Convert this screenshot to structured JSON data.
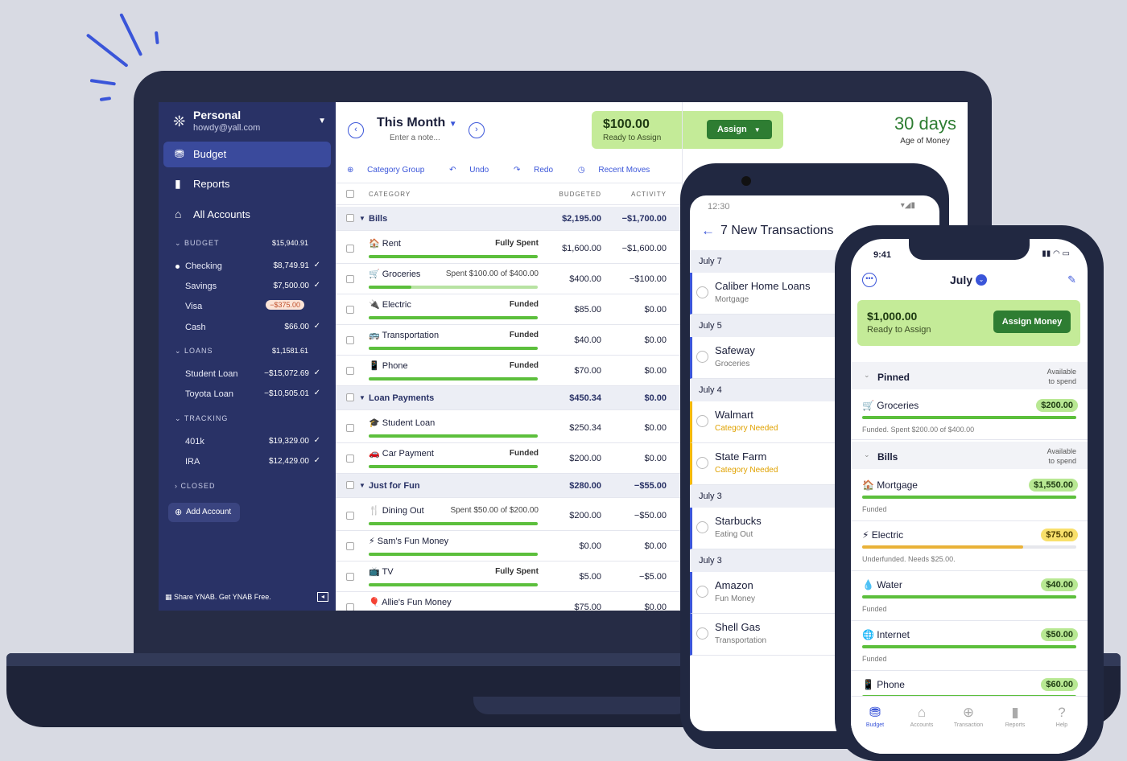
{
  "sidebar": {
    "budget_name": "Personal",
    "email": "howdy@yall.com",
    "nav": [
      {
        "label": "Budget",
        "icon": "budget-icon"
      },
      {
        "label": "Reports",
        "icon": "reports-icon"
      },
      {
        "label": "All Accounts",
        "icon": "bank-icon"
      }
    ],
    "groups": {
      "budget": {
        "label": "BUDGET",
        "amount": "$15,940.91"
      },
      "loans": {
        "label": "LOANS",
        "amount": "$1,1581.61"
      },
      "tracking": {
        "label": "TRACKING",
        "amount": ""
      },
      "closed": {
        "label": "CLOSED",
        "amount": ""
      }
    },
    "accounts": [
      {
        "name": "Checking",
        "amount": "$8,749.91"
      },
      {
        "name": "Savings",
        "amount": "$7,500.00"
      },
      {
        "name": "Visa",
        "amount": "−$375.00"
      },
      {
        "name": "Cash",
        "amount": "$66.00"
      },
      {
        "name": "Student Loan",
        "amount": "−$15,072.69"
      },
      {
        "name": "Toyota Loan",
        "amount": "−$10,505.01"
      },
      {
        "name": "401k",
        "amount": "$19,329.00"
      },
      {
        "name": "IRA",
        "amount": "$12,429.00"
      }
    ],
    "add_account": "Add Account",
    "share_text": "Share YNAB. Get YNAB Free."
  },
  "header": {
    "month": "This Month",
    "note_placeholder": "Enter a note...",
    "ready_amount": "$100.00",
    "ready_label": "Ready to Assign",
    "assign_label": "Assign",
    "age_value": "30 days",
    "age_label": "Age of Money"
  },
  "toolbar": {
    "category_group": "Category Group",
    "undo": "Undo",
    "redo": "Redo",
    "recent_moves": "Recent Moves"
  },
  "table": {
    "col_category": "CATEGORY",
    "col_budgeted": "BUDGETED",
    "col_activity": "ACTIVITY",
    "rows": [
      {
        "type": "group",
        "name": "Bills",
        "budgeted": "$2,195.00",
        "activity": "−$1,700.00"
      },
      {
        "type": "cat",
        "name": "🏠 Rent",
        "status": "Fully Spent",
        "budgeted": "$1,600.00",
        "activity": "−$1,600.00",
        "fill": 1.0
      },
      {
        "type": "cat",
        "name": "🛒 Groceries",
        "status": "Spent $100.00 of $400.00",
        "budgeted": "$400.00",
        "activity": "−$100.00",
        "fill": 0.25
      },
      {
        "type": "cat",
        "name": "🔌 Electric",
        "status": "Funded",
        "budgeted": "$85.00",
        "activity": "$0.00",
        "fill": 1.0
      },
      {
        "type": "cat",
        "name": "🚌 Transportation",
        "status": "Funded",
        "budgeted": "$40.00",
        "activity": "$0.00",
        "fill": 1.0
      },
      {
        "type": "cat",
        "name": "📱 Phone",
        "status": "Funded",
        "budgeted": "$70.00",
        "activity": "$0.00",
        "fill": 1.0
      },
      {
        "type": "group",
        "name": "Loan Payments",
        "budgeted": "$450.34",
        "activity": "$0.00"
      },
      {
        "type": "cat",
        "name": "🎓 Student Loan",
        "status": "",
        "budgeted": "$250.34",
        "activity": "$0.00",
        "fill": 1.0
      },
      {
        "type": "cat",
        "name": "🚗 Car Payment",
        "status": "Funded",
        "budgeted": "$200.00",
        "activity": "$0.00",
        "fill": 1.0
      },
      {
        "type": "group",
        "name": "Just for Fun",
        "budgeted": "$280.00",
        "activity": "−$55.00"
      },
      {
        "type": "cat",
        "name": "🍴 Dining Out",
        "status": "Spent $50.00 of $200.00",
        "budgeted": "$200.00",
        "activity": "−$50.00",
        "fill": 1.0
      },
      {
        "type": "cat",
        "name": "⚡ Sam's Fun Money",
        "status": "",
        "budgeted": "$0.00",
        "activity": "$0.00",
        "fill": 1.0
      },
      {
        "type": "cat",
        "name": "📺 TV",
        "status": "Fully Spent",
        "budgeted": "$5.00",
        "activity": "−$5.00",
        "fill": 1.0
      },
      {
        "type": "cat",
        "name": "🎈 Allie's Fun Money",
        "status": "",
        "budgeted": "$75.00",
        "activity": "$0.00",
        "fill": 1.0
      }
    ]
  },
  "android": {
    "time": "12:30",
    "title": "7 New Transactions",
    "items": [
      {
        "type": "date",
        "label": "July 7"
      },
      {
        "type": "tx",
        "name": "Caliber Home Loans",
        "sub": "Mortgage",
        "warn": false
      },
      {
        "type": "date",
        "label": "July 5"
      },
      {
        "type": "tx",
        "name": "Safeway",
        "sub": "Groceries",
        "warn": false
      },
      {
        "type": "date",
        "label": "July 4"
      },
      {
        "type": "tx",
        "name": "Walmart",
        "sub": "Category Needed",
        "warn": true
      },
      {
        "type": "tx",
        "name": "State Farm",
        "sub": "Category Needed",
        "warn": true
      },
      {
        "type": "date",
        "label": "July 3"
      },
      {
        "type": "tx",
        "name": "Starbucks",
        "sub": "Eating Out",
        "warn": false
      },
      {
        "type": "date",
        "label": "July 3"
      },
      {
        "type": "tx",
        "name": "Amazon",
        "sub": "Fun Money",
        "warn": false
      },
      {
        "type": "tx",
        "name": "Shell Gas",
        "sub": "Transportation",
        "warn": false
      }
    ]
  },
  "iphone": {
    "time": "9:41",
    "month": "July",
    "ready_amount": "$1,000.00",
    "ready_label": "Ready to Assign",
    "assign_label": "Assign Money",
    "available_label_1": "Available",
    "available_label_2": "to spend",
    "pinned_label": "Pinned",
    "bills_label": "Bills",
    "items": [
      {
        "name": "🛒 Groceries",
        "amount": "$200.00",
        "sub": "Funded. Spent $200.00 of $400.00",
        "warn": false,
        "fill": 1.0
      },
      {
        "name": "🏠 Mortgage",
        "amount": "$1,550.00",
        "sub": "Funded",
        "warn": false,
        "fill": 1.0
      },
      {
        "name": "⚡ Electric",
        "amount": "$75.00",
        "sub": "Underfunded. Needs $25.00.",
        "warn": true,
        "fill": 0.75
      },
      {
        "name": "💧 Water",
        "amount": "$40.00",
        "sub": "Funded",
        "warn": false,
        "fill": 1.0
      },
      {
        "name": "🌐 Internet",
        "amount": "$50.00",
        "sub": "Funded",
        "warn": false,
        "fill": 1.0
      },
      {
        "name": "📱 Phone",
        "amount": "$60.00",
        "sub": "",
        "warn": false,
        "fill": 1.0
      }
    ],
    "tabs": [
      {
        "label": "Budget",
        "icon": "budget-icon"
      },
      {
        "label": "Accounts",
        "icon": "bank-icon"
      },
      {
        "label": "Transaction",
        "icon": "plus-icon"
      },
      {
        "label": "Reports",
        "icon": "reports-icon"
      },
      {
        "label": "Help",
        "icon": "help-icon"
      }
    ]
  },
  "colors": {
    "sidebar": "#293266",
    "accent": "#3a55d9",
    "green": "#2e7d32",
    "ready_bg": "#c4eb98"
  }
}
